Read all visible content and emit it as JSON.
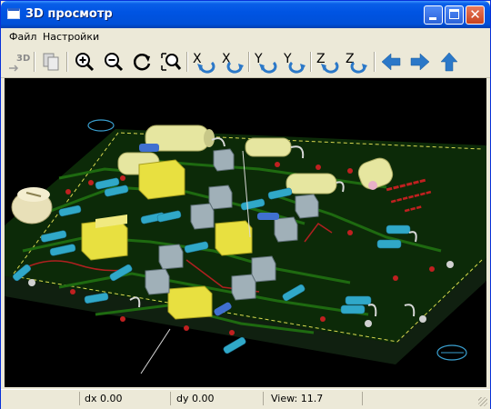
{
  "window": {
    "title": "3D просмотр"
  },
  "menu": {
    "items": [
      "Файл",
      "Настройки"
    ]
  },
  "toolbar": {
    "buttons": [
      {
        "name": "reload-3d-button",
        "icon": "3d-reload-icon"
      },
      {
        "name": "copy-image-button",
        "icon": "copy-icon"
      },
      {
        "name": "zoom-in-button",
        "icon": "zoom-in-icon"
      },
      {
        "name": "zoom-out-button",
        "icon": "zoom-out-icon"
      },
      {
        "name": "redraw-button",
        "icon": "refresh-icon"
      },
      {
        "name": "zoom-fit-button",
        "icon": "zoom-fit-icon"
      },
      {
        "name": "rotate-x-neg-button",
        "icon": "rotate-x-icon"
      },
      {
        "name": "rotate-x-pos-button",
        "icon": "rotate-x-icon"
      },
      {
        "name": "rotate-y-neg-button",
        "icon": "rotate-y-icon"
      },
      {
        "name": "rotate-y-pos-button",
        "icon": "rotate-y-icon"
      },
      {
        "name": "rotate-z-neg-button",
        "icon": "rotate-z-icon"
      },
      {
        "name": "rotate-z-pos-button",
        "icon": "rotate-z-icon"
      },
      {
        "name": "pan-left-button",
        "icon": "arrow-left-icon"
      },
      {
        "name": "pan-right-button",
        "icon": "arrow-right-icon"
      },
      {
        "name": "pan-up-button",
        "icon": "arrow-up-icon"
      }
    ],
    "labels": {
      "reload": "3D",
      "x": "X",
      "y": "Y",
      "z": "Z"
    }
  },
  "status": {
    "dx": "dx 0.00",
    "dy": "dy 0.00",
    "view": "View: 11.7"
  },
  "colors": {
    "board": "#0c2a08",
    "trace": "#1e6a10",
    "capacitor": "#e6e6a0",
    "resistor": "#30a8c8",
    "relay": "#e8e040",
    "transistor": "#a0b0b8"
  }
}
